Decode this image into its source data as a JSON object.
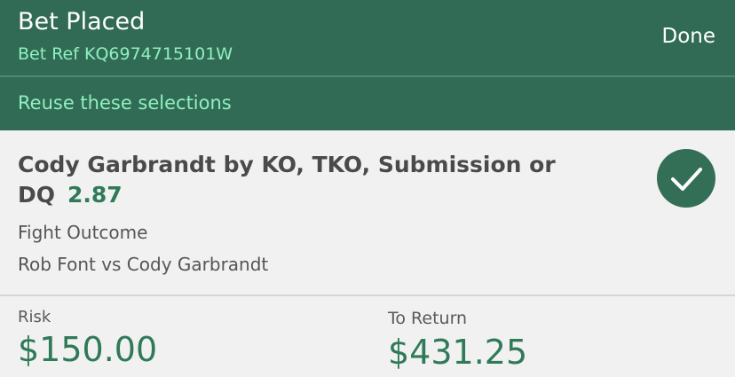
{
  "header": {
    "title": "Bet Placed",
    "bet_ref": "Bet Ref KQ6974715101W",
    "done_label": "Done"
  },
  "reuse": {
    "label": "Reuse these selections"
  },
  "selection": {
    "name": "Cody Garbrandt by KO, TKO, Submission or DQ",
    "odds": "2.87",
    "market": "Fight Outcome",
    "event": "Rob Font vs Cody Garbrandt",
    "status_icon": "checkmark-icon"
  },
  "totals": {
    "risk_label": "Risk",
    "risk_value": "$150.00",
    "return_label": "To Return",
    "return_value": "$431.25"
  },
  "colors": {
    "header_bg": "#326b55",
    "accent_text": "#8ef0c0",
    "amount_green": "#2f7a58",
    "check_bg": "#336f57"
  }
}
